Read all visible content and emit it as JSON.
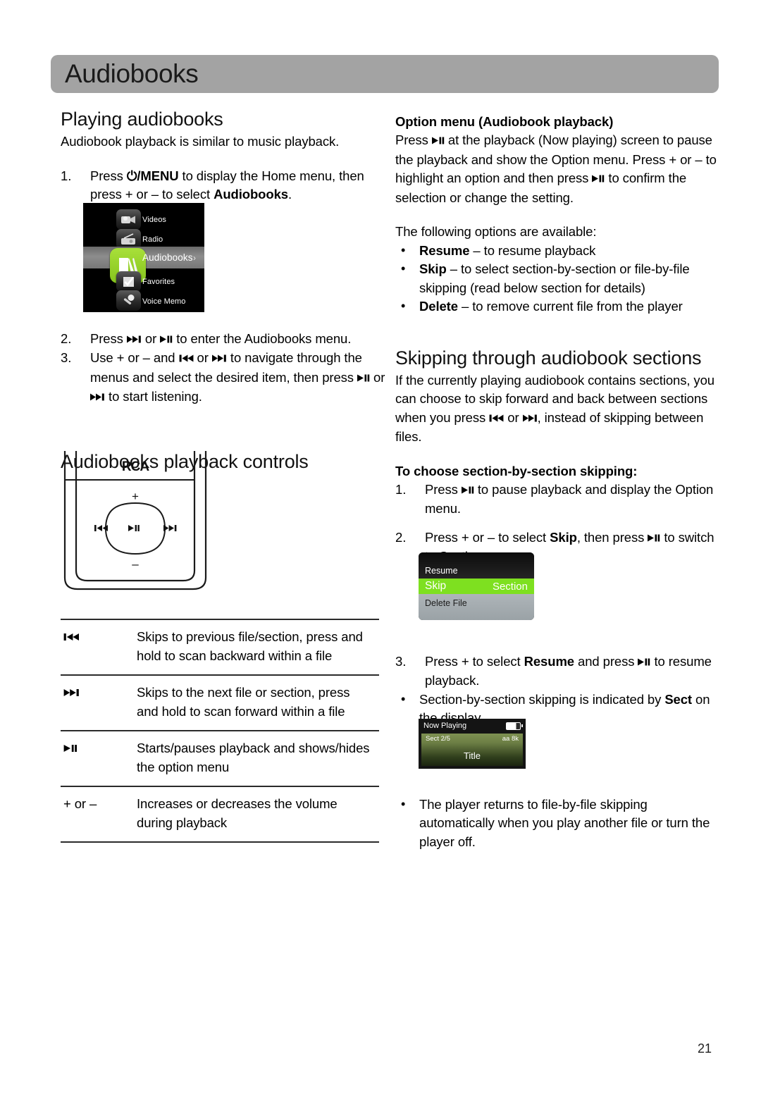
{
  "page": {
    "header_title": "Audiobooks",
    "page_number": "21",
    "accent_green": "#8fd620",
    "band_gray": "#a3a3a3"
  },
  "left_column": {
    "heading": "Playing audiobooks",
    "intro": "Audiobook playback is similar to music playback.",
    "steps": [
      {
        "marker": "1.",
        "text_a": "Press ",
        "bold_a": "⏻/MENU",
        "text_b": " to display the Home menu, then press + or – to select ",
        "bold_b": "Audiobooks",
        "text_c": "."
      },
      {
        "marker": "2.",
        "text_a": "Press ",
        "icon_a": "next-track-icon",
        "text_b": " or ",
        "icon_b": "play-pause-icon",
        "text_c": " to enter the Audiobooks menu."
      },
      {
        "marker": "3.",
        "text_a": "Use + or – and ",
        "icon_a": "prev-track-icon",
        "text_b": " or ",
        "icon_b": "next-track-icon",
        "text_c": " to navigate through the menus and select the desired item, then press ",
        "icon_c": "play-pause-icon",
        "text_d": " or ",
        "icon_d": "next-track-icon",
        "text_e": " to start listening."
      }
    ],
    "home_menu_screenshot": {
      "items": [
        {
          "label": "Videos",
          "icon": "videos-icon",
          "selected": false
        },
        {
          "label": "Radio",
          "icon": "radio-icon",
          "selected": false
        },
        {
          "label": "Audiobooks",
          "icon": "audiobooks-icon",
          "selected": true,
          "chevron": "›"
        },
        {
          "label": "Favorites",
          "icon": "favorites-icon",
          "selected": false
        },
        {
          "label": "Voice Memo",
          "icon": "voice-memo-icon",
          "selected": false
        }
      ]
    },
    "controls_heading": "Audiobooks playback controls",
    "player_diagram": {
      "brand": "RCA",
      "plus_label": "+",
      "minus_label": "–",
      "prev_label": "prev-track-icon",
      "next_label": "next-track-icon",
      "playpause_label": "play-pause-icon"
    },
    "controls_table": {
      "rows": [
        {
          "key_icon": "prev-track-icon",
          "key_text": "",
          "description": "Skips to previous file/section, press and hold to scan backward within a file"
        },
        {
          "key_icon": "next-track-icon",
          "key_text": "",
          "description": "Skips to the next file or section, press and hold to scan forward within a file"
        },
        {
          "key_icon": "play-pause-icon",
          "key_text": "",
          "description": "Starts/pauses playback and shows/hides the option menu"
        },
        {
          "key_icon": "",
          "key_text": "+ or –",
          "description": "Increases or decreases the volume during playback"
        }
      ]
    }
  },
  "right_column": {
    "option_menu_heading": "Option menu (Audiobook playback)",
    "option_menu_paragraph": {
      "text_a": "Press ",
      "icon_a": "play-pause-icon",
      "text_b": " at the playback (Now playing) screen to pause the playback and show the Option menu. Press + or – to highlight an option and then press ",
      "icon_b": "play-pause-icon",
      "text_c": " to confirm the selection or change the setting."
    },
    "options_intro": "The following options are available:",
    "options": [
      {
        "bold": "Resume",
        "text": " – to resume playback"
      },
      {
        "bold": "Skip",
        "text": " – to select section-by-section or file-by-file skipping (read below section for details)"
      },
      {
        "bold": "Delete",
        "text": " – to remove current file from the player"
      }
    ],
    "skipping_heading": "Skipping through audiobook sections",
    "skipping_paragraph": {
      "text_a": "If the currently playing audiobook contains sections, you can choose to skip forward and back between sections when you press ",
      "icon_a": "prev-track-icon",
      "text_b": " or ",
      "icon_b": "next-track-icon",
      "text_c": ", instead of skipping between files."
    },
    "choose_heading": "To choose section-by-section skipping:",
    "choose_steps": [
      {
        "marker": "1.",
        "text_a": "Press ",
        "icon_a": "play-pause-icon",
        "text_b": " to pause playback and display the Option menu."
      },
      {
        "marker": "2.",
        "text_a": "Press + or – to select ",
        "bold_a": "Skip",
        "text_b": ", then press ",
        "icon_a": "play-pause-icon",
        "text_c": " to switch to Section."
      },
      {
        "marker": "3.",
        "text_a": "Press + to select ",
        "bold_a": "Resume",
        "text_b": " and press ",
        "icon_a": "play-pause-icon",
        "text_c": " to resume playback."
      }
    ],
    "option_menu_screenshot": {
      "rows": [
        {
          "label": "Resume",
          "value": "",
          "highlight": false
        },
        {
          "label": "Skip",
          "value": "Section",
          "highlight": true
        },
        {
          "label": "Delete File",
          "value": "",
          "highlight": false
        }
      ]
    },
    "final_bullets": [
      {
        "text_a": "Section-by-section skipping is indicated by ",
        "bold_a": "Sect",
        "text_b": " on the display."
      },
      {
        "text_a": "The player returns to file-by-file skipping automatically when you play another file or turn the player off.",
        "bold_a": "",
        "text_b": ""
      }
    ],
    "now_playing_screenshot": {
      "title": "Now Playing",
      "section_indicator": "Sect 2/5",
      "format_indicator": "aa 8k",
      "track_title": "Title",
      "battery": "battery-icon"
    }
  }
}
